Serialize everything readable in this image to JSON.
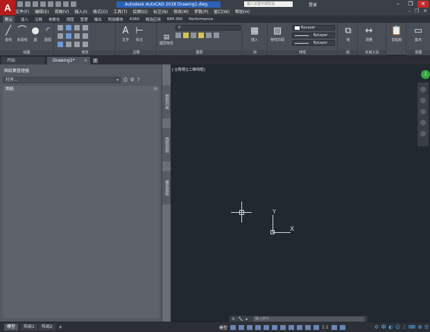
{
  "app": {
    "logo": "A",
    "title": "Autodesk AutoCAD 2018    Drawing1.dwg",
    "search_placeholder": "键入关键字或短语",
    "user": "登录"
  },
  "menu": [
    "文件(F)",
    "编辑(E)",
    "视图(V)",
    "插入(I)",
    "格式(O)",
    "工具(T)",
    "绘图(D)",
    "标注(N)",
    "修改(M)",
    "参数(P)",
    "窗口(W)",
    "帮助(H)"
  ],
  "ribbon_tabs": [
    "默认",
    "插入",
    "注释",
    "参数化",
    "视图",
    "管理",
    "输出",
    "附加模块",
    "A360",
    "精选应用",
    "BIM 360",
    "Performance"
  ],
  "ribbon_panels": {
    "draw": {
      "title": "绘图",
      "line": "直线",
      "polyline": "多段线",
      "circle": "圆",
      "arc": "圆弧"
    },
    "modify": {
      "title": "修改"
    },
    "annotation": {
      "title": "注释",
      "text": "文字",
      "dimension": "标注"
    },
    "layers": {
      "title": "图层",
      "layer_props": "图层特性",
      "combo_value": "0"
    },
    "block": {
      "title": "块",
      "insert": "插入"
    },
    "properties": {
      "title": "特性",
      "match": "特性匹配",
      "color": "ByLayer",
      "linetype": "ByLayer",
      "lineweight": "ByLayer"
    },
    "groups": {
      "title": "组",
      "group": "组"
    },
    "utilities": {
      "title": "实用工具",
      "measure": "测量"
    },
    "clipboard": {
      "title": "剪贴板",
      "paste": "剪贴板"
    },
    "view": {
      "title": "视图",
      "base": "基点"
    }
  },
  "doc_tabs": {
    "start": "开始",
    "drawing": "Drawing1*"
  },
  "palette": {
    "title": "图纸集管理器",
    "open_label": "打开...",
    "sheets_header": "图纸",
    "side_tabs": [
      "图纸列表",
      "图纸视图",
      "模型视图"
    ]
  },
  "canvas": {
    "viewport_label": "[-][俯视][二维线框]",
    "ucs_x": "X",
    "ucs_y": "Y",
    "viewcube": "上"
  },
  "command": {
    "placeholder": "键入命令"
  },
  "status": {
    "layouts": [
      "模型",
      "布局1",
      "布局2"
    ],
    "model_label": "模型",
    "scale": "1:1",
    "ime": "中"
  },
  "colors": {
    "canvas_bg": "#212830",
    "title_highlight": "#2b62b8",
    "logo_red": "#b41d1d",
    "viewcube_green": "#35a53c"
  }
}
